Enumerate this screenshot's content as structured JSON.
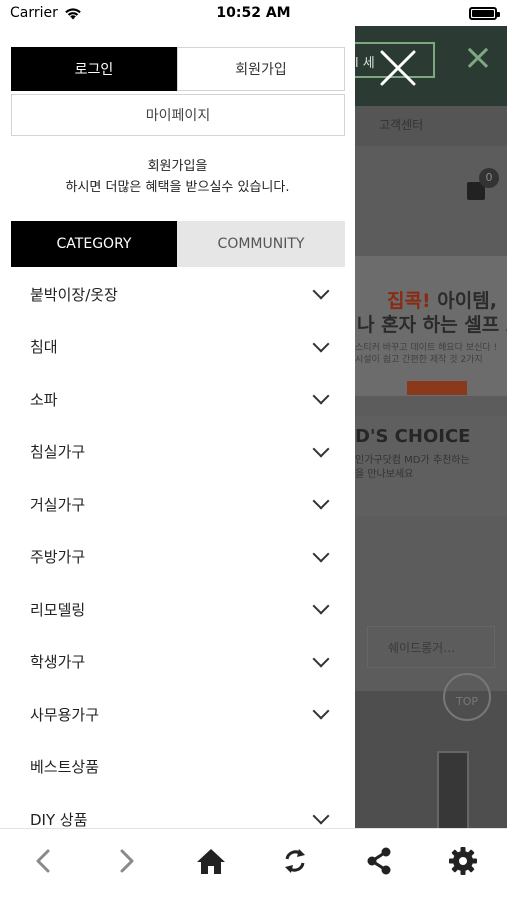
{
  "status_bar": {
    "carrier": "Carrier",
    "time": "10:52 AM"
  },
  "drawer": {
    "login_label": "로그인",
    "join_label": "회원가입",
    "mypage_label": "마이페이지",
    "promo_line1": "회원가입을",
    "promo_line2": "하시면 더많은 혜택을 받으실수 있습니다.",
    "tabs": {
      "category": "CATEGORY",
      "community": "COMMUNITY"
    },
    "menu": [
      {
        "label": "붙박이장/옷장",
        "expandable": true
      },
      {
        "label": "침대",
        "expandable": true
      },
      {
        "label": "소파",
        "expandable": true
      },
      {
        "label": "침실가구",
        "expandable": true
      },
      {
        "label": "거실가구",
        "expandable": true
      },
      {
        "label": "주방가구",
        "expandable": true
      },
      {
        "label": "리모델링",
        "expandable": true
      },
      {
        "label": "학생가구",
        "expandable": true
      },
      {
        "label": "사무용가구",
        "expandable": true
      },
      {
        "label": "베스트상품",
        "expandable": false
      },
      {
        "label": "DIY 상품",
        "expandable": true
      }
    ]
  },
  "background": {
    "search_text": "l 세",
    "nav_text": "고객센터",
    "cart_count": "0",
    "banner_highlight": "집콕!",
    "banner_line1_rest": " 아이템,",
    "banner_line2": "나 혼자 하는 셀프 도",
    "banner_small1": "스티커 바꾸고 데이트 해요다 보신다 !",
    "banner_small2": "시설이 쉽고 간편한 제작 것 2가지 ",
    "md_title": "D'S CHOICE",
    "md_sub1": "인가구닷컴 MD가 추천하는",
    "md_sub2": "을 만나보세요",
    "card_text": "쉐이드롱거…",
    "top_label": "TOP"
  },
  "toolbar": {
    "icons": [
      "back-icon",
      "forward-icon",
      "home-icon",
      "refresh-icon",
      "share-icon",
      "settings-icon"
    ]
  }
}
